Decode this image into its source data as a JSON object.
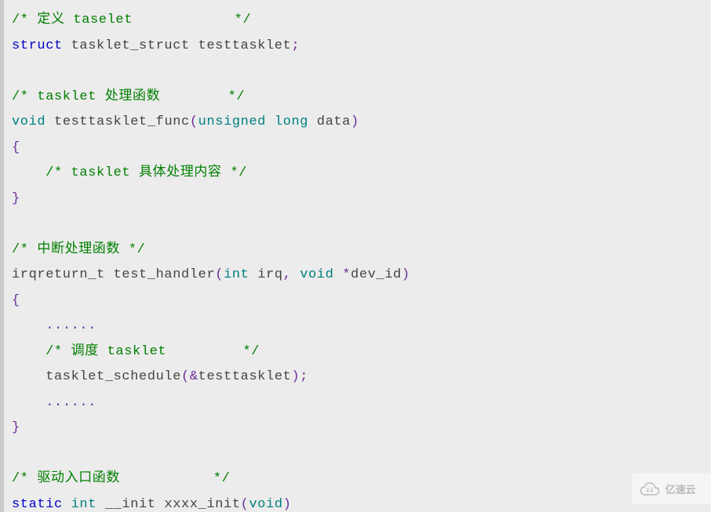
{
  "code": {
    "lines": [
      {
        "tokens": [
          {
            "cls": "t-comment",
            "text": "/* 定义 taselet            */"
          }
        ]
      },
      {
        "tokens": [
          {
            "cls": "t-keyword",
            "text": "struct"
          },
          {
            "cls": "t-ident",
            "text": " tasklet_struct testtasklet"
          },
          {
            "cls": "t-punct",
            "text": ";"
          }
        ]
      },
      {
        "tokens": [
          {
            "cls": "t-ident",
            "text": " "
          }
        ]
      },
      {
        "tokens": [
          {
            "cls": "t-comment",
            "text": "/* tasklet 处理函数        */"
          }
        ]
      },
      {
        "tokens": [
          {
            "cls": "t-type",
            "text": "void"
          },
          {
            "cls": "t-ident",
            "text": " testtasklet_func"
          },
          {
            "cls": "t-punct",
            "text": "("
          },
          {
            "cls": "t-type",
            "text": "unsigned long"
          },
          {
            "cls": "t-ident",
            "text": " data"
          },
          {
            "cls": "t-punct",
            "text": ")"
          }
        ]
      },
      {
        "tokens": [
          {
            "cls": "t-punct",
            "text": "{"
          }
        ]
      },
      {
        "tokens": [
          {
            "cls": "t-ident",
            "text": "    "
          },
          {
            "cls": "t-comment",
            "text": "/* tasklet 具体处理内容 */"
          }
        ]
      },
      {
        "tokens": [
          {
            "cls": "t-punct",
            "text": "}"
          }
        ]
      },
      {
        "tokens": [
          {
            "cls": "t-ident",
            "text": " "
          }
        ]
      },
      {
        "tokens": [
          {
            "cls": "t-comment",
            "text": "/* 中断处理函数 */"
          }
        ]
      },
      {
        "tokens": [
          {
            "cls": "t-ident",
            "text": "irqreturn_t test_handler"
          },
          {
            "cls": "t-punct",
            "text": "("
          },
          {
            "cls": "t-type",
            "text": "int"
          },
          {
            "cls": "t-ident",
            "text": " irq"
          },
          {
            "cls": "t-punct",
            "text": ","
          },
          {
            "cls": "t-ident",
            "text": " "
          },
          {
            "cls": "t-type",
            "text": "void"
          },
          {
            "cls": "t-ident",
            "text": " "
          },
          {
            "cls": "t-punct",
            "text": "*"
          },
          {
            "cls": "t-ident",
            "text": "dev_id"
          },
          {
            "cls": "t-punct",
            "text": ")"
          }
        ]
      },
      {
        "tokens": [
          {
            "cls": "t-punct",
            "text": "{"
          }
        ]
      },
      {
        "tokens": [
          {
            "cls": "t-ident",
            "text": "    "
          },
          {
            "cls": "t-punct",
            "text": "......"
          }
        ]
      },
      {
        "tokens": [
          {
            "cls": "t-ident",
            "text": "    "
          },
          {
            "cls": "t-comment",
            "text": "/* 调度 tasklet         */"
          }
        ]
      },
      {
        "tokens": [
          {
            "cls": "t-ident",
            "text": "    tasklet_schedule"
          },
          {
            "cls": "t-punct",
            "text": "(&"
          },
          {
            "cls": "t-ident",
            "text": "testtasklet"
          },
          {
            "cls": "t-punct",
            "text": ");"
          }
        ]
      },
      {
        "tokens": [
          {
            "cls": "t-ident",
            "text": "    "
          },
          {
            "cls": "t-punct",
            "text": "......"
          }
        ]
      },
      {
        "tokens": [
          {
            "cls": "t-punct",
            "text": "}"
          }
        ]
      },
      {
        "tokens": [
          {
            "cls": "t-ident",
            "text": " "
          }
        ]
      },
      {
        "tokens": [
          {
            "cls": "t-comment",
            "text": "/* 驱动入口函数           */"
          }
        ]
      },
      {
        "tokens": [
          {
            "cls": "t-keyword",
            "text": "static"
          },
          {
            "cls": "t-ident",
            "text": " "
          },
          {
            "cls": "t-type",
            "text": "int"
          },
          {
            "cls": "t-ident",
            "text": " __init xxxx_init"
          },
          {
            "cls": "t-punct",
            "text": "("
          },
          {
            "cls": "t-type",
            "text": "void"
          },
          {
            "cls": "t-punct",
            "text": ")"
          }
        ]
      }
    ]
  },
  "watermark": {
    "text": "亿速云"
  }
}
